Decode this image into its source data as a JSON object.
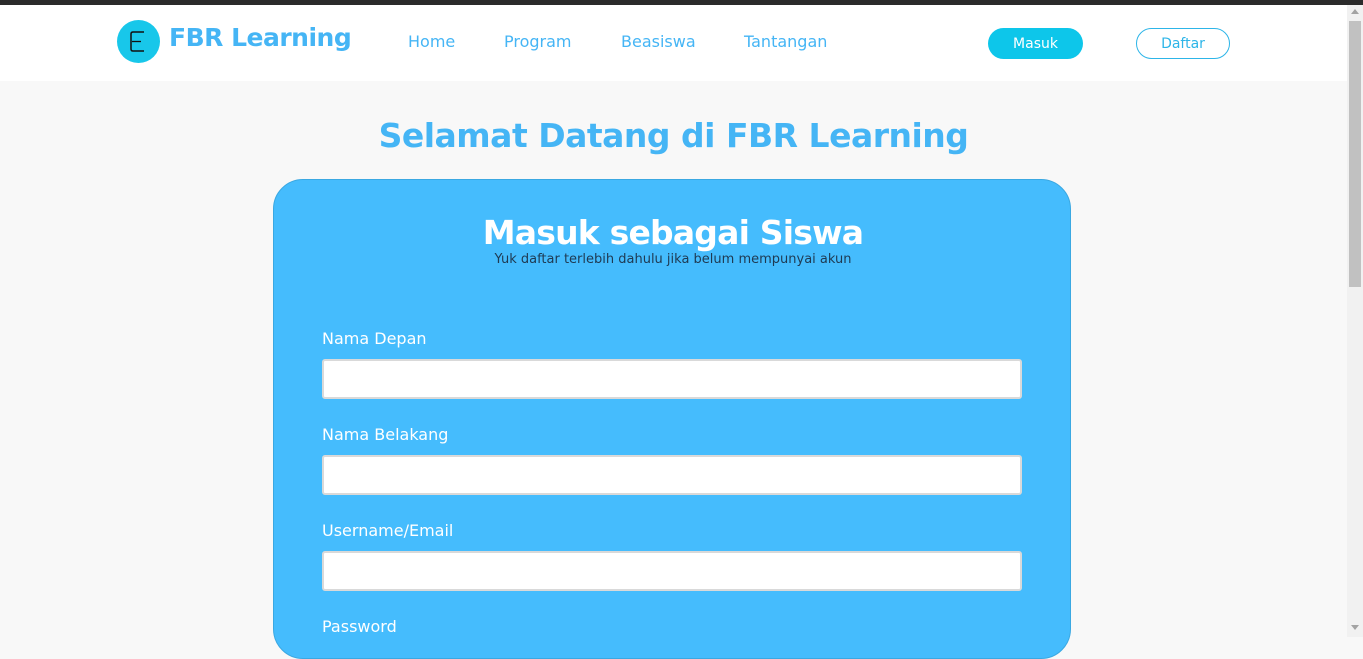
{
  "brand": {
    "name": "FBR Learning",
    "logo_icon": "e-letter-icon",
    "accent": "#45b5f5"
  },
  "nav": {
    "links": [
      "Home",
      "Program",
      "Beasiswa",
      "Tantangan"
    ],
    "login_label": "Masuk",
    "register_label": "Daftar"
  },
  "page": {
    "welcome": "Selamat Datang di FBR Learning"
  },
  "form": {
    "title": "Masuk sebagai Siswa",
    "subtitle": "Yuk daftar terlebih dahulu jika belum mempunyai akun",
    "fields": [
      {
        "label": "Nama Depan",
        "value": "",
        "placeholder": ""
      },
      {
        "label": "Nama Belakang",
        "value": "",
        "placeholder": ""
      },
      {
        "label": "Username/Email",
        "value": "",
        "placeholder": ""
      },
      {
        "label": "Password",
        "value": "",
        "placeholder": ""
      }
    ],
    "card_color": "#45bcfd"
  }
}
